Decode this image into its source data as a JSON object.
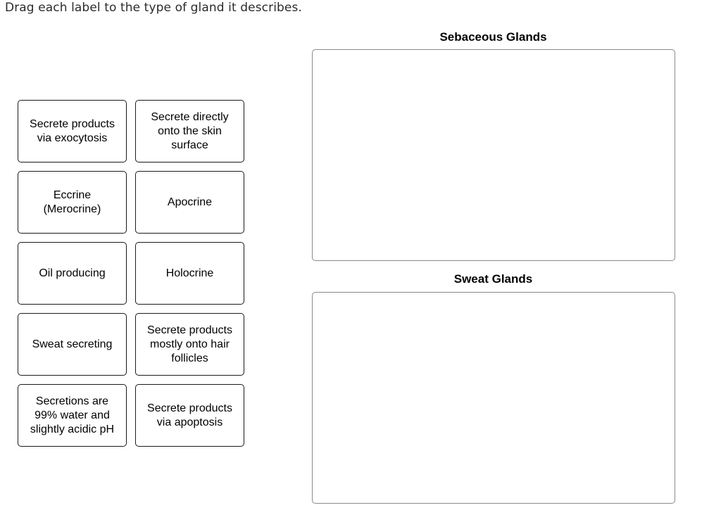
{
  "instructions": "Drag each label to the type of gland it describes.",
  "labels": [
    "Secrete products\nvia exocytosis",
    "Secrete directly\nonto the skin\nsurface",
    "Eccrine\n(Merocrine)",
    "Apocrine",
    "Oil producing",
    "Holocrine",
    "Sweat secreting",
    "Secrete products\nmostly onto hair\nfollicles",
    "Secretions are\n99% water and\nslightly acidic pH",
    "Secrete products\nvia apoptosis"
  ],
  "drop_zones": [
    {
      "title": "Sebaceous Glands",
      "items": []
    },
    {
      "title": "Sweat Glands",
      "items": []
    }
  ]
}
